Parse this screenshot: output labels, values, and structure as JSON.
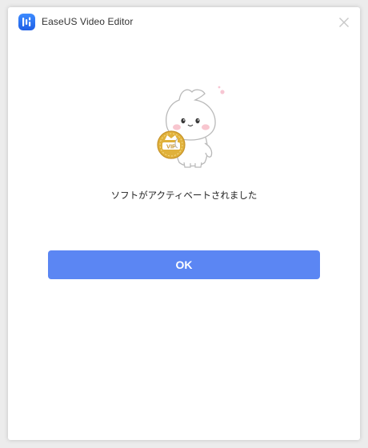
{
  "window": {
    "title": "EaseUS Video Editor",
    "close_icon": "close-icon",
    "app_icon": "easeus-video-editor-logo"
  },
  "content": {
    "illustration": "mascot-vip-badge-illustration",
    "badge_text": "VIP",
    "message": "ソフトがアクティベートされました"
  },
  "actions": {
    "ok_label": "OK"
  },
  "colors": {
    "primary_button": "#5b86f3",
    "background": "#ffffff",
    "badge_gold": "#d9a52b"
  }
}
